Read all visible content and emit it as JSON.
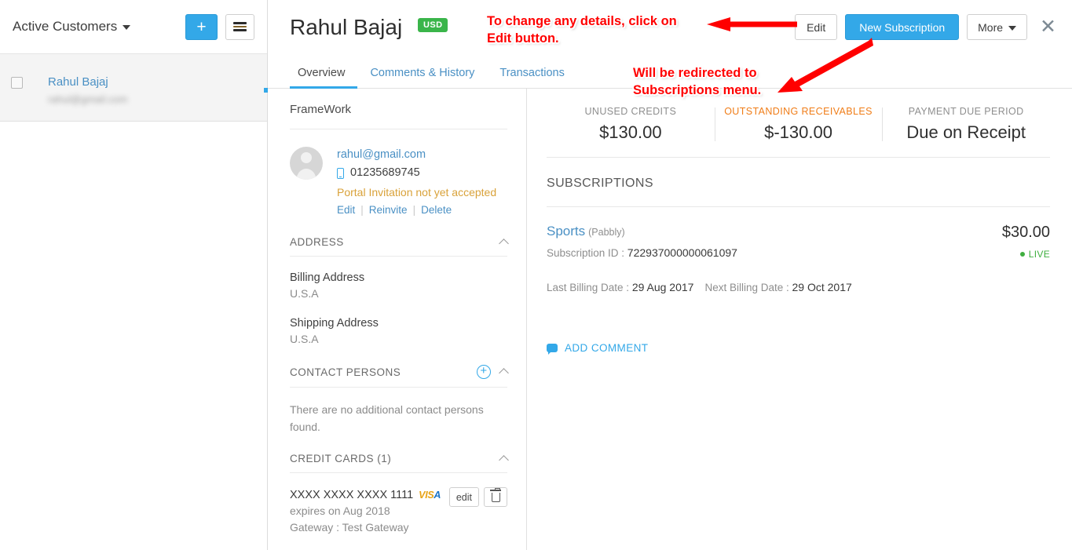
{
  "sidebar": {
    "filter_label": "Active Customers",
    "add_button_label": "+",
    "menu_button_label": "menu",
    "customers": [
      {
        "name": "Rahul Bajaj",
        "email": "rahul@gmail.com"
      }
    ]
  },
  "header": {
    "customer_name": "Rahul Bajaj",
    "currency_badge": "USD",
    "edit_label": "Edit",
    "new_subscription_label": "New Subscription",
    "more_label": "More",
    "close_label": "✕"
  },
  "tabs": [
    {
      "label": "Overview",
      "active": true
    },
    {
      "label": "Comments & History",
      "active": false
    },
    {
      "label": "Transactions",
      "active": false
    }
  ],
  "left_panel": {
    "company": "FrameWork",
    "contact": {
      "email": "rahul@gmail.com",
      "phone": "01235689745",
      "portal_status": "Portal Invitation not yet accepted",
      "links": [
        "Edit",
        "Reinvite",
        "Delete"
      ]
    },
    "address_section": {
      "title": "ADDRESS",
      "billing_label": "Billing Address",
      "billing_value": "U.S.A",
      "shipping_label": "Shipping Address",
      "shipping_value": "U.S.A"
    },
    "contact_persons_section": {
      "title": "CONTACT PERSONS",
      "empty_text": "There are no additional contact persons found."
    },
    "credit_cards_section": {
      "title": "CREDIT CARDS (1)",
      "card_number": "XXXX XXXX XXXX 1111",
      "card_brand_1": "VIS",
      "card_brand_2": "A",
      "expires": "expires on Aug 2018",
      "gateway": "Gateway : Test Gateway",
      "edit_label": "edit",
      "delete_label": "delete"
    }
  },
  "right_panel": {
    "stats": [
      {
        "label": "UNUSED CREDITS",
        "value": "$130.00",
        "highlight": false
      },
      {
        "label": "OUTSTANDING RECEIVABLES",
        "value": "$-130.00",
        "highlight": true
      },
      {
        "label": "PAYMENT DUE PERIOD",
        "value": "Due on Receipt",
        "highlight": false
      }
    ],
    "subscriptions_title": "SUBSCRIPTIONS",
    "subscription": {
      "name": "Sports",
      "plan": "(Pabbly)",
      "id_label": "Subscription ID : ",
      "id_value": "722937000000061097",
      "amount": "$30.00",
      "status": "LIVE",
      "last_billing_label": "Last Billing Date : ",
      "last_billing_value": "29 Aug 2017",
      "next_billing_label": "Next Billing Date : ",
      "next_billing_value": "29 Oct 2017"
    },
    "add_comment_label": "ADD COMMENT"
  },
  "annotations": [
    {
      "text": "To change any details, click on\nEdit button."
    },
    {
      "text": "Will be redirected to\nSubscriptions menu."
    }
  ],
  "colors": {
    "accent_blue": "#33a8e8",
    "link_blue": "#4a90c4",
    "badge_green": "#3ab54a",
    "warn_orange": "#f07d18",
    "annotation_red": "#ff0000"
  }
}
